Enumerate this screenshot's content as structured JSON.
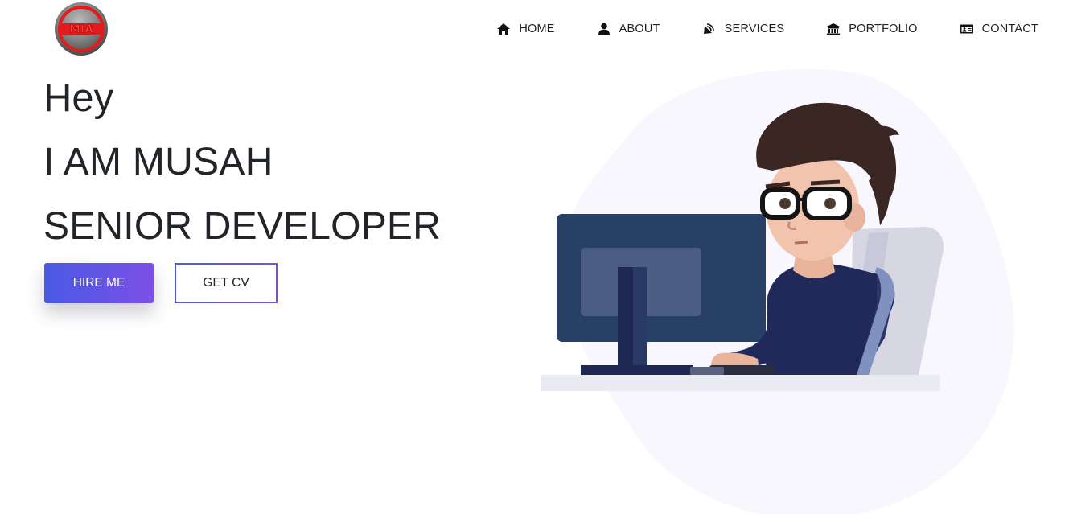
{
  "header": {
    "logo_icon": "mia-logo-icon",
    "logo_text": "MIA",
    "nav": [
      {
        "label": "HOME",
        "icon": "home-icon"
      },
      {
        "label": "ABOUT",
        "icon": "user-icon"
      },
      {
        "label": "SERVICES",
        "icon": "satellite-dish-icon"
      },
      {
        "label": "PORTFOLIO",
        "icon": "university-icon"
      },
      {
        "label": "CONTACT",
        "icon": "address-card-icon"
      }
    ]
  },
  "hero": {
    "greeting": "Hey",
    "name_line": "I AM MUSAH",
    "title_line": "SENIOR DEVELOPER",
    "buttons": {
      "hire": "HIRE ME",
      "cv": "GET CV"
    }
  },
  "colors": {
    "text": "#212529",
    "accent_start": "#4a5ae3",
    "accent_end": "#7b4fe6",
    "blob": "#f7f7fd",
    "monitor": "#2a4066",
    "shirt": "#20295a"
  },
  "illustration_icon": "developer-at-computer-illustration"
}
